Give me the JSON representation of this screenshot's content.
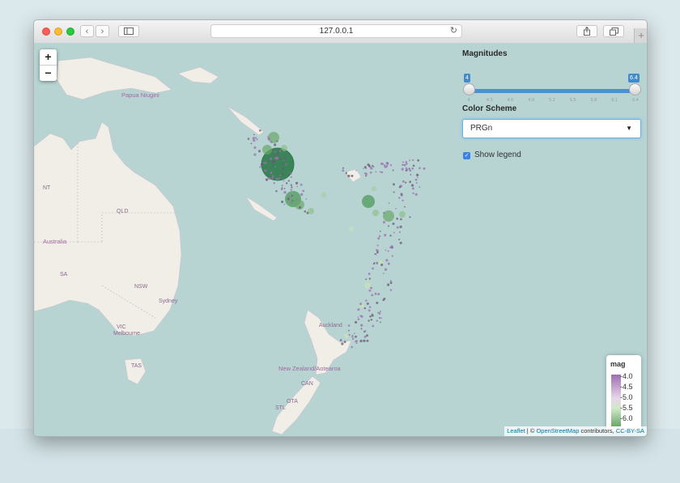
{
  "browser": {
    "address": "127.0.0.1",
    "new_tab_label": "+"
  },
  "map": {
    "zoom_in_label": "+",
    "zoom_out_label": "−",
    "places": {
      "papua": "Papua Niugini",
      "nt": "NT",
      "qld": "QLD",
      "australia": "Australia",
      "sa": "SA",
      "nsw": "NSW",
      "sydney": "Sydney",
      "vic": "VIC",
      "melbourne": "Melbourne",
      "tas": "TAS",
      "auckland": "Auckland",
      "nz": "New Zealand/Aotearoa",
      "can": "CAN",
      "ota": "OTA",
      "stl": "STL"
    },
    "colors": {
      "water": "#b7d4d3",
      "land": "#f0eee6",
      "large_quake": "#2e7a4a",
      "small_quake": "#9b6fb0"
    }
  },
  "controls": {
    "magnitudes_label": "Magnitudes",
    "slider_min": "4",
    "slider_max": "6.4",
    "slider_range": [
      4,
      6.4
    ],
    "ticks": [
      "4",
      "4.3",
      "4.6",
      "4.9",
      "5.2",
      "5.5",
      "5.8",
      "6.1",
      "6.4"
    ],
    "color_scheme_label": "Color Scheme",
    "color_scheme_value": "PRGn",
    "show_legend_label": "Show legend",
    "show_legend_checked": true
  },
  "legend": {
    "title": "mag",
    "labels": [
      "-4.0",
      "-4.5",
      "-5.0",
      "-5.5",
      "-6.0"
    ]
  },
  "attribution": {
    "leaflet": "Leaflet",
    "sep": " | © ",
    "osm": "OpenStreetMap",
    "contributors": " contributors, ",
    "license": "CC-BY-SA"
  }
}
